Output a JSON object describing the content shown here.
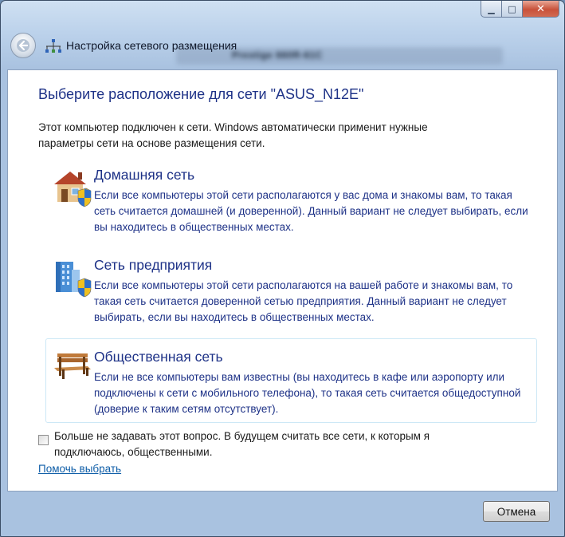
{
  "window": {
    "title": "Настройка сетевого размещения",
    "background_title": "Prestige 660R-61C",
    "minimize": "▁",
    "maximize": "□",
    "close": "✕"
  },
  "main": {
    "heading": "Выберите расположение для сети \"ASUS_N12E\"",
    "intro": "Этот компьютер подключен к сети. Windows автоматически применит нужные параметры сети на основе размещения сети.",
    "options": [
      {
        "icon": "home-network-icon",
        "title": "Домашняя сеть",
        "description": "Если все компьютеры этой сети располагаются у вас дома и знакомы вам, то такая сеть считается домашней (и доверенной). Данный вариант не следует выбирать, если вы находитесь в общественных местах."
      },
      {
        "icon": "work-network-icon",
        "title": "Сеть предприятия",
        "description": "Если все компьютеры этой сети располагаются на вашей работе и знакомы вам, то такая сеть считается доверенной сетью предприятия. Данный вариант не следует выбирать, если вы находитесь в общественных местах."
      },
      {
        "icon": "public-network-bench-icon",
        "title": "Общественная сеть",
        "description": "Если не все компьютеры вам известны (вы находитесь в кафе или аэропорту или подключены к сети с мобильного телефона), то такая сеть считается общедоступной (доверие к таким сетям отсутствует)."
      }
    ],
    "checkbox_label": "Больше не задавать этот вопрос. В будущем считать все сети, к которым я подключаюсь, общественными.",
    "checkbox_checked": false,
    "help_link": "Помочь выбрать"
  },
  "footer": {
    "cancel": "Отмена"
  },
  "colors": {
    "heading": "#1e3287",
    "link": "#0f5ea8",
    "frame": "#bcd2eb"
  }
}
